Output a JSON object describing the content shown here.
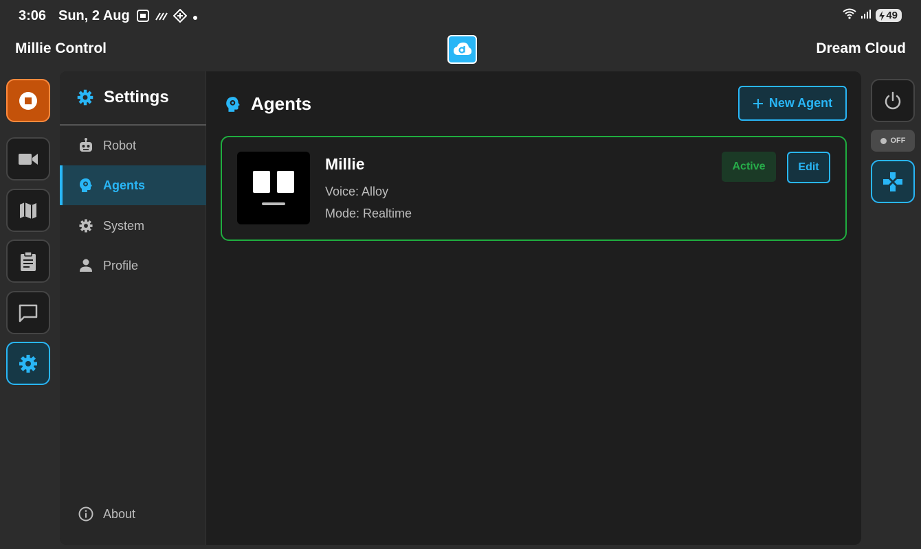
{
  "status_bar": {
    "time": "3:06",
    "date": "Sun, 2 Aug",
    "battery": "49"
  },
  "header": {
    "left_title": "Millie Control",
    "right_title": "Dream Cloud",
    "logo_icon": "cloud-d-logo-icon"
  },
  "left_rail": {
    "items": [
      "stop-icon",
      "video-camera-icon",
      "map-icon",
      "clipboard-icon",
      "chat-icon",
      "gear-icon"
    ],
    "active": "gear-icon"
  },
  "right_rail": {
    "toggle_label": "OFF",
    "items": [
      "power-icon",
      "gamepad-icon"
    ]
  },
  "settings": {
    "title": "Settings",
    "nav": [
      {
        "label": "Robot",
        "icon": "robot-icon"
      },
      {
        "label": "Agents",
        "icon": "head-icon"
      },
      {
        "label": "System",
        "icon": "gear-icon"
      },
      {
        "label": "Profile",
        "icon": "person-icon"
      }
    ],
    "selected": "Agents",
    "about": "About"
  },
  "agents": {
    "title": "Agents",
    "new_button": "New Agent",
    "list": [
      {
        "name": "Millie",
        "voice": "Voice: Alloy",
        "mode": "Mode: Realtime",
        "status": "Active",
        "edit": "Edit"
      }
    ]
  },
  "colors": {
    "accent": "#29b6f6",
    "stop": "#c4520a",
    "active_green": "#27ae4a",
    "background": "#2c2c2c",
    "panel": "#1e1e1e"
  }
}
